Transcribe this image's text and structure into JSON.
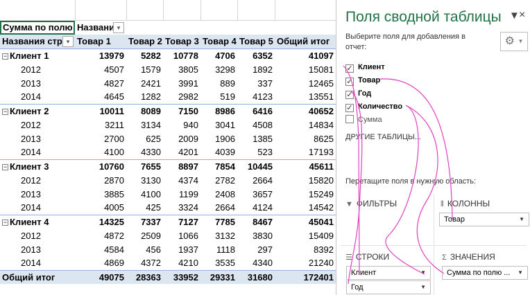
{
  "sheet": {
    "a1": "Сумма по полю",
    "b1": "Названия",
    "header": [
      "Названия стро",
      "Товар 1",
      "Товар 2",
      "Товар 3",
      "Товар 4",
      "Товар 5",
      "Общий итог"
    ],
    "rows": [
      {
        "type": "client",
        "label": "Клиент 1",
        "values": [
          "13979",
          "5282",
          "10778",
          "4706",
          "6352",
          "41097"
        ]
      },
      {
        "type": "year",
        "label": "2012",
        "values": [
          "4507",
          "1579",
          "3805",
          "3298",
          "1892",
          "15081"
        ]
      },
      {
        "type": "year",
        "label": "2013",
        "values": [
          "4827",
          "2421",
          "3991",
          "889",
          "337",
          "12465"
        ]
      },
      {
        "type": "year",
        "label": "2014",
        "values": [
          "4645",
          "1282",
          "2982",
          "519",
          "4123",
          "13551"
        ]
      },
      {
        "type": "client",
        "label": "Клиент 2",
        "values": [
          "10011",
          "8089",
          "7150",
          "8986",
          "6416",
          "40652"
        ]
      },
      {
        "type": "year",
        "label": "2012",
        "values": [
          "3211",
          "3134",
          "940",
          "3041",
          "4508",
          "14834"
        ]
      },
      {
        "type": "year",
        "label": "2013",
        "values": [
          "2700",
          "625",
          "2009",
          "1906",
          "1385",
          "8625"
        ]
      },
      {
        "type": "year",
        "label": "2014",
        "values": [
          "4100",
          "4330",
          "4201",
          "4039",
          "523",
          "17193"
        ]
      },
      {
        "type": "client",
        "label": "Клиент 3",
        "values": [
          "10760",
          "7655",
          "8897",
          "7854",
          "10445",
          "45611"
        ]
      },
      {
        "type": "year",
        "label": "2012",
        "values": [
          "2870",
          "3130",
          "4374",
          "2782",
          "2664",
          "15820"
        ]
      },
      {
        "type": "year",
        "label": "2013",
        "values": [
          "3885",
          "4100",
          "1199",
          "2408",
          "3657",
          "15249"
        ]
      },
      {
        "type": "year",
        "label": "2014",
        "values": [
          "4005",
          "425",
          "3324",
          "2664",
          "4124",
          "14542"
        ]
      },
      {
        "type": "client",
        "label": "Клиент 4",
        "values": [
          "14325",
          "7337",
          "7127",
          "7785",
          "8467",
          "45041"
        ]
      },
      {
        "type": "year",
        "label": "2012",
        "values": [
          "4872",
          "2509",
          "1066",
          "3132",
          "3830",
          "15409"
        ]
      },
      {
        "type": "year",
        "label": "2013",
        "values": [
          "4584",
          "456",
          "1937",
          "1118",
          "297",
          "8392"
        ]
      },
      {
        "type": "year",
        "label": "2014",
        "values": [
          "4869",
          "4372",
          "4210",
          "3535",
          "4340",
          "21240"
        ]
      }
    ],
    "total": {
      "label": "Общий итог",
      "values": [
        "49075",
        "28363",
        "33952",
        "29331",
        "31680",
        "172401"
      ]
    }
  },
  "pane": {
    "title": "Поля сводной таблицы",
    "close_arrow": "▼",
    "close_x": "×",
    "hint": "Выберите поля для добавления в отчет:",
    "fields": [
      {
        "label": "Клиент",
        "checked": true
      },
      {
        "label": "Товар",
        "checked": true
      },
      {
        "label": "Год",
        "checked": true
      },
      {
        "label": "Количество",
        "checked": true
      },
      {
        "label": "Сумма",
        "checked": false
      }
    ],
    "more_tables": "ДРУГИЕ ТАБЛИЦЫ...",
    "drag_hint": "Перетащите поля в нужную область:",
    "areas": {
      "filters": "ФИЛЬТРЫ",
      "columns": "КОЛОННЫ",
      "rows": "СТРОКИ",
      "values": "ЗНАЧЕНИЯ"
    },
    "columns_items": [
      "Товар"
    ],
    "rows_items": [
      "Клиент",
      "Год"
    ],
    "values_items": [
      "Сумма по полю ..."
    ]
  },
  "colors": {
    "accent": "#217346",
    "header_fill": "#dce6f1",
    "annotation": "#e040c0"
  },
  "icons": {
    "dropdown": "▾",
    "collapse": "−",
    "gear": "⚙",
    "filter": "funnel-icon",
    "columns": "columns-icon",
    "rows": "rows-icon",
    "values": "sigma-icon"
  }
}
